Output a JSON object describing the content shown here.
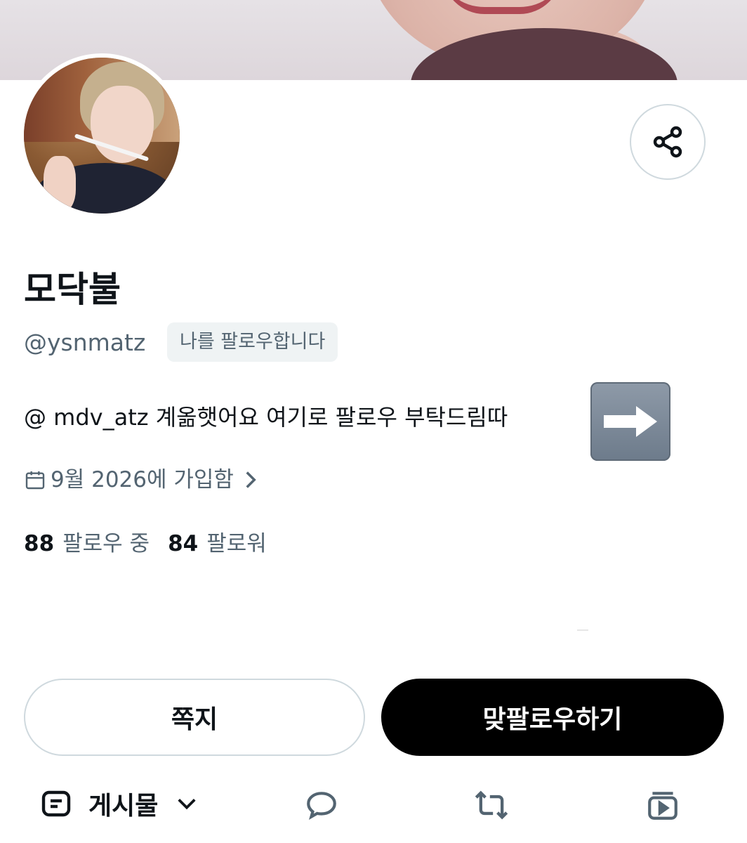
{
  "profile": {
    "display_name": "모닥불",
    "handle": "@ysnmatz",
    "follows_you_badge": "나를 팔로우합니다",
    "bio": "@ mdv_atz 계옮햇어요 여기로 팔로우 부탁드림따",
    "bio_emoji": "right-arrow-emoji",
    "joined": "9월 2026에 가입함",
    "following_count": "88",
    "following_label": "팔로우 중",
    "followers_count": "84",
    "followers_label": "팔로워"
  },
  "actions": {
    "message_label": "쪽지",
    "follow_back_label": "맞팔로우하기"
  },
  "tabs": {
    "posts_label": "게시물",
    "icons": [
      "posts-icon",
      "chevron-down-icon",
      "reply-icon",
      "repost-icon",
      "media-icon"
    ]
  },
  "icons": {
    "share": "share-icon",
    "calendar": "calendar-icon",
    "chevron": "chevron-right-icon"
  },
  "colors": {
    "primary_text": "#0f1419",
    "secondary_text": "#536471",
    "border": "#cfd9de",
    "follow_button_bg": "#000000"
  }
}
